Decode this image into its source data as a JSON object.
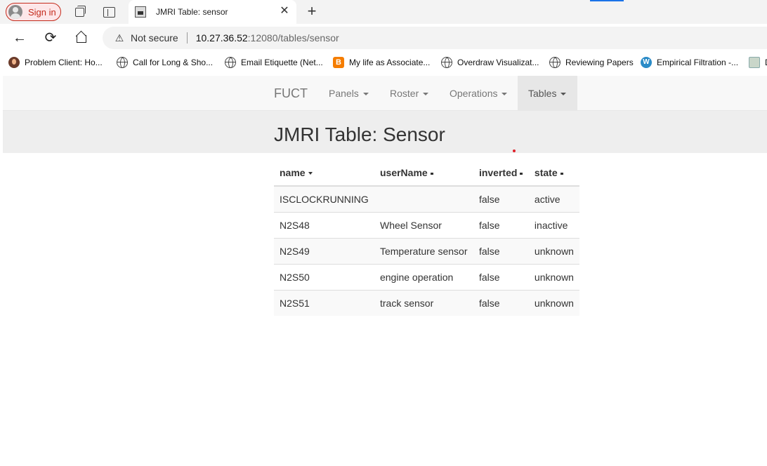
{
  "browser": {
    "sign_in_label": "Sign in",
    "tab": {
      "title": "JMRI Table: sensor",
      "close_glyph": "✕"
    },
    "new_tab_glyph": "+",
    "nav": {
      "back_glyph": "←",
      "reload_glyph": "⟳"
    },
    "address": {
      "security_warning": "Not secure",
      "url_host": "10.27.36.52",
      "url_rest": ":12080/tables/sensor"
    },
    "bookmarks": [
      {
        "label": "Problem Client: Ho...",
        "icon": "avatar-icon"
      },
      {
        "label": "Call for Long & Sho...",
        "icon": "globe-icon"
      },
      {
        "label": "Email Etiquette (Net...",
        "icon": "globe-icon"
      },
      {
        "label": "My life as Associate...",
        "icon": "blogger-icon"
      },
      {
        "label": "Overdraw Visualizat...",
        "icon": "globe-icon"
      },
      {
        "label": "Reviewing Papers",
        "icon": "globe-icon"
      },
      {
        "label": "Empirical Filtration -...",
        "icon": "wordpress-icon"
      },
      {
        "label": "D",
        "icon": "image-icon"
      }
    ]
  },
  "navbar": {
    "brand": "FUCT",
    "items": [
      {
        "label": "Panels",
        "active": false
      },
      {
        "label": "Roster",
        "active": false
      },
      {
        "label": "Operations",
        "active": false
      },
      {
        "label": "Tables",
        "active": true
      }
    ]
  },
  "page": {
    "title": "JMRI Table: Sensor"
  },
  "table": {
    "columns": [
      {
        "label": "name",
        "sort_indicator": "triangle"
      },
      {
        "label": "userName",
        "sort_indicator": "square"
      },
      {
        "label": "inverted",
        "sort_indicator": "square"
      },
      {
        "label": "state",
        "sort_indicator": "square"
      }
    ],
    "rows": [
      [
        "ISCLOCKRUNNING",
        "",
        "false",
        "active"
      ],
      [
        "N2S48",
        "Wheel Sensor",
        "false",
        "inactive"
      ],
      [
        "N2S49",
        "Temperature sensor",
        "false",
        "unknown"
      ],
      [
        "N2S50",
        "engine operation",
        "false",
        "unknown"
      ],
      [
        "N2S51",
        "track sensor",
        "false",
        "unknown"
      ]
    ]
  },
  "colors": {
    "signin_accent": "#c42b1c",
    "navbar_bg": "#f8f8f8",
    "active_nav_bg": "#e7e7e7",
    "jumbotron_bg": "#eeeeee",
    "stripe": "#f9f9f9"
  }
}
